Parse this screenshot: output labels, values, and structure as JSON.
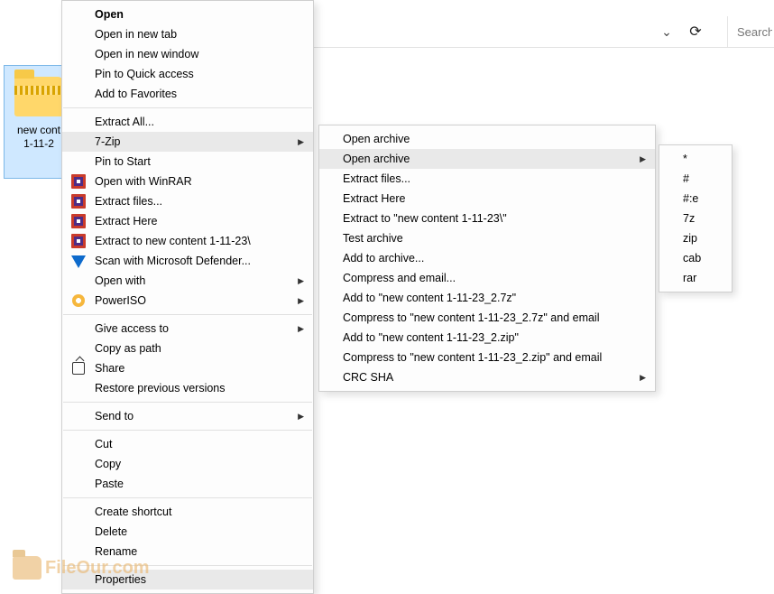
{
  "toolbar": {
    "search_placeholder": "Search N"
  },
  "file": {
    "name": "new cont\n1-11-2"
  },
  "watermark": "FileOur.com",
  "menu_main": [
    {
      "kind": "item",
      "label": "Open",
      "bold": true
    },
    {
      "kind": "item",
      "label": "Open in new tab"
    },
    {
      "kind": "item",
      "label": "Open in new window"
    },
    {
      "kind": "item",
      "label": "Pin to Quick access"
    },
    {
      "kind": "item",
      "label": "Add to Favorites"
    },
    {
      "kind": "sep"
    },
    {
      "kind": "item",
      "label": "Extract All..."
    },
    {
      "kind": "item",
      "label": "7-Zip",
      "sub": true,
      "hl": true
    },
    {
      "kind": "item",
      "label": "Pin to Start"
    },
    {
      "kind": "item",
      "label": "Open with WinRAR",
      "icon": "winrar"
    },
    {
      "kind": "item",
      "label": "Extract files...",
      "icon": "winrar"
    },
    {
      "kind": "item",
      "label": "Extract Here",
      "icon": "winrar"
    },
    {
      "kind": "item",
      "label": "Extract to new content 1-11-23\\",
      "icon": "winrar"
    },
    {
      "kind": "item",
      "label": "Scan with Microsoft Defender...",
      "icon": "defender"
    },
    {
      "kind": "item",
      "label": "Open with",
      "sub": true
    },
    {
      "kind": "item",
      "label": "PowerISO",
      "icon": "poweriso",
      "sub": true
    },
    {
      "kind": "sep"
    },
    {
      "kind": "item",
      "label": "Give access to",
      "sub": true
    },
    {
      "kind": "item",
      "label": "Copy as path"
    },
    {
      "kind": "item",
      "label": "Share",
      "icon": "share"
    },
    {
      "kind": "item",
      "label": "Restore previous versions"
    },
    {
      "kind": "sep"
    },
    {
      "kind": "item",
      "label": "Send to",
      "sub": true
    },
    {
      "kind": "sep"
    },
    {
      "kind": "item",
      "label": "Cut"
    },
    {
      "kind": "item",
      "label": "Copy"
    },
    {
      "kind": "item",
      "label": "Paste"
    },
    {
      "kind": "sep"
    },
    {
      "kind": "item",
      "label": "Create shortcut"
    },
    {
      "kind": "item",
      "label": "Delete"
    },
    {
      "kind": "item",
      "label": "Rename"
    },
    {
      "kind": "sep"
    },
    {
      "kind": "item",
      "label": "Properties",
      "hl": true
    }
  ],
  "menu_7zip": [
    {
      "kind": "item",
      "label": "Open archive"
    },
    {
      "kind": "item",
      "label": "Open archive",
      "sub": true,
      "hl": true
    },
    {
      "kind": "item",
      "label": "Extract files..."
    },
    {
      "kind": "item",
      "label": "Extract Here"
    },
    {
      "kind": "item",
      "label": "Extract to \"new content 1-11-23\\\""
    },
    {
      "kind": "item",
      "label": "Test archive"
    },
    {
      "kind": "item",
      "label": "Add to archive..."
    },
    {
      "kind": "item",
      "label": "Compress and email..."
    },
    {
      "kind": "item",
      "label": "Add to \"new content 1-11-23_2.7z\""
    },
    {
      "kind": "item",
      "label": "Compress to \"new content 1-11-23_2.7z\" and email"
    },
    {
      "kind": "item",
      "label": "Add to \"new content 1-11-23_2.zip\""
    },
    {
      "kind": "item",
      "label": "Compress to \"new content 1-11-23_2.zip\" and email"
    },
    {
      "kind": "item",
      "label": "CRC SHA",
      "sub": true
    }
  ],
  "menu_formats": [
    {
      "kind": "item",
      "label": "*"
    },
    {
      "kind": "item",
      "label": "#"
    },
    {
      "kind": "item",
      "label": "#:e"
    },
    {
      "kind": "item",
      "label": "7z"
    },
    {
      "kind": "item",
      "label": "zip"
    },
    {
      "kind": "item",
      "label": "cab"
    },
    {
      "kind": "item",
      "label": "rar"
    }
  ]
}
